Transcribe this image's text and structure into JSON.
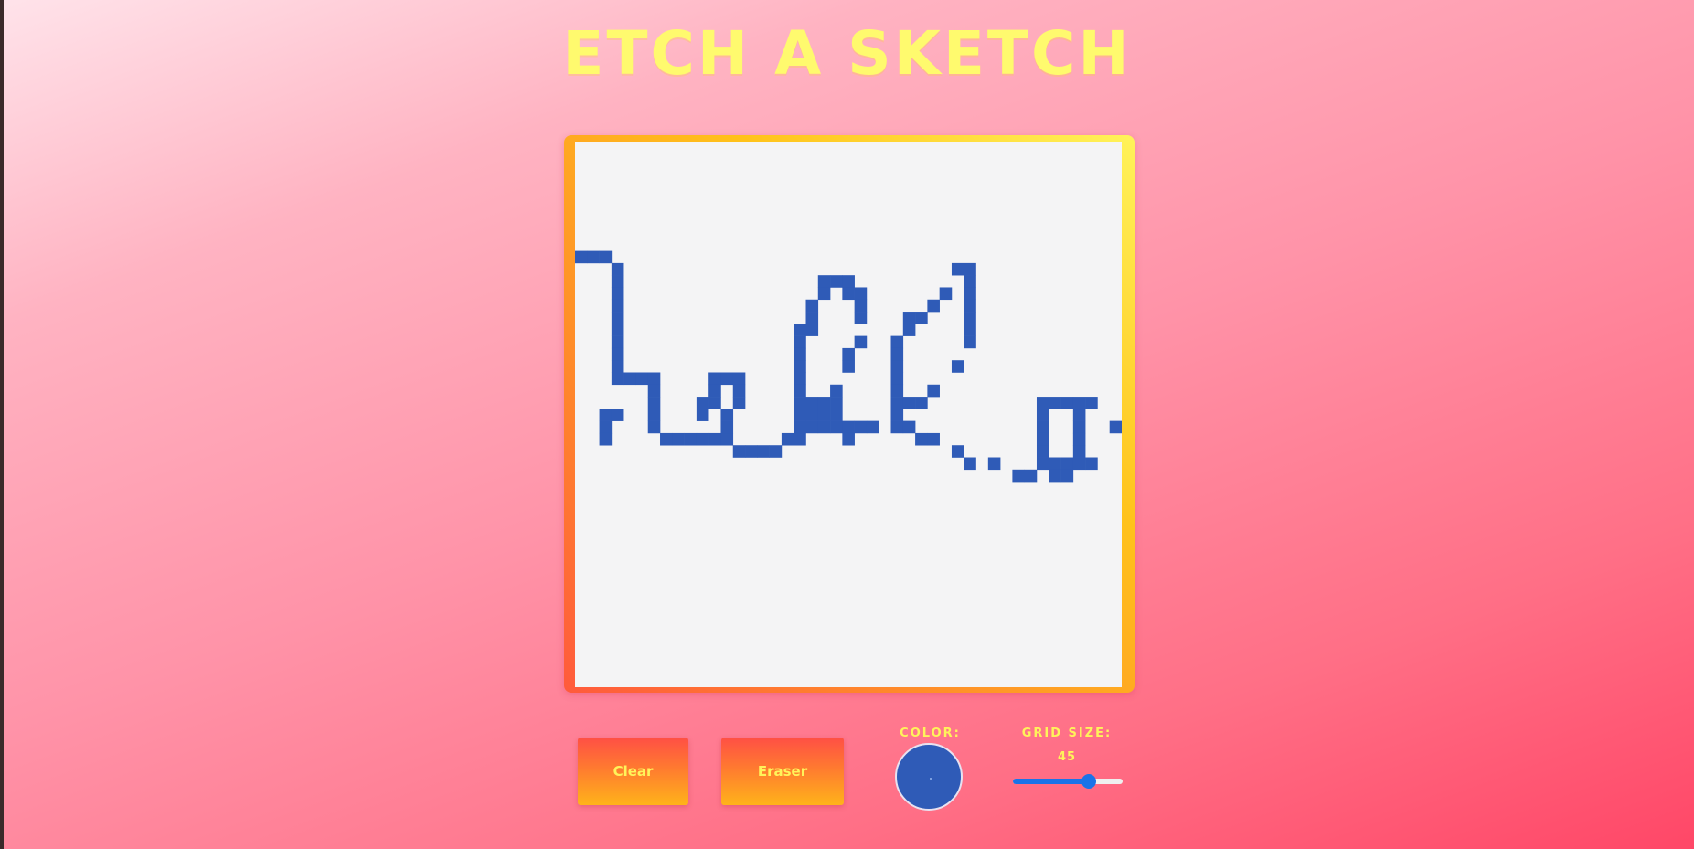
{
  "app": {
    "title": "Etch A Sketch"
  },
  "canvas": {
    "grid_size": 45,
    "background_color": "#f4f4f5",
    "ink_color": "#2f5bb7",
    "drawing_text": "hello"
  },
  "controls": {
    "clear_label": "Clear",
    "eraser_label": "Eraser",
    "color_label": "COLOR:",
    "grid_label": "GRID SIZE:",
    "grid_value": "45",
    "selected_color": "#2f5bb7",
    "slider_min": 1,
    "slider_max": 64,
    "slider_fraction": 0.69
  },
  "colors": {
    "accent_yellow": "#fff35a",
    "slider_blue": "#1a73e8"
  }
}
